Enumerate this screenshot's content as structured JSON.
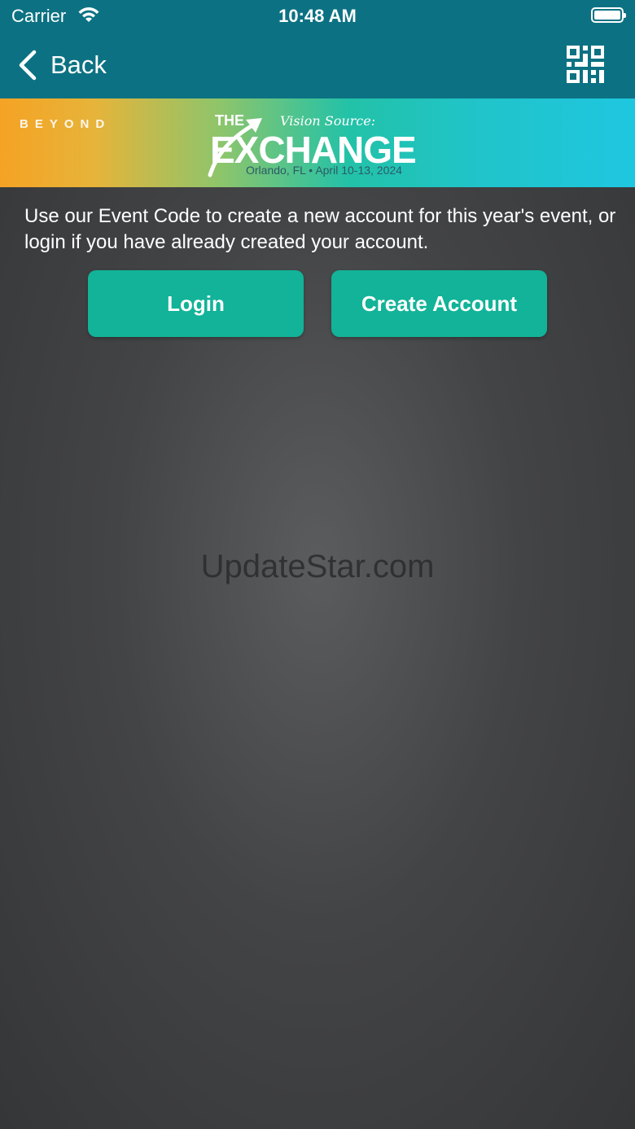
{
  "status_bar": {
    "carrier": "Carrier",
    "time": "10:48 AM"
  },
  "nav": {
    "back_label": "Back",
    "qr_icon": "qr-code-icon"
  },
  "banner": {
    "left_logo": "BEYOND",
    "vision_source": "Vision Source:",
    "the": "THE",
    "exchange": "EXCHANGE",
    "location_dates": "Orlando, FL • April 10-13, 2024"
  },
  "main": {
    "intro_text": "Use our Event Code to create a new account for this year's event, or login if you have already created your account.",
    "login_label": "Login",
    "create_account_label": "Create Account"
  },
  "watermark": "UpdateStar.com",
  "colors": {
    "nav_teal": "#0c7283",
    "button_green": "#12b398",
    "background": "#3a3b3d"
  }
}
